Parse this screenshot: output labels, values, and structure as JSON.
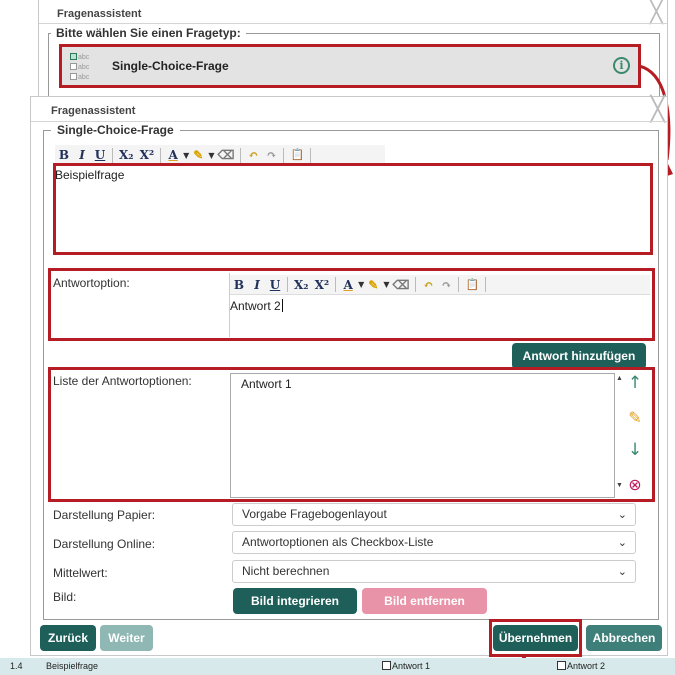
{
  "background_dialog": {
    "title": "Fragenassistent",
    "close_glyph": "╳",
    "legend": "Bitte wählen Sie einen Fragetyp:",
    "type_icon_lines": [
      "abc",
      "abc",
      "abc"
    ],
    "selected_type": "Single-Choice-Frage",
    "info_glyph": "i"
  },
  "dialog": {
    "title": "Fragenassistent",
    "close_glyph": "╳",
    "legend": "Single-Choice-Frage"
  },
  "toolbar": {
    "bold": "B",
    "italic": "I",
    "underline": "U",
    "subscript": "X₂",
    "superscript": "X²",
    "font_color": "A",
    "highlight_icon": "✎",
    "clear_format_icon": "⌫",
    "undo_icon": "↶",
    "redo_icon": "↷",
    "paste_icon": "📋",
    "dropdown_glyph": "▼"
  },
  "question": {
    "text": "Beispielfrage"
  },
  "answer": {
    "label": "Antwortoption:",
    "text": "Antwort 2",
    "add_button": "Antwort hinzufügen"
  },
  "list": {
    "label": "Liste der Antwortoptionen:",
    "items": [
      "Antwort 1"
    ],
    "up_icon": "↑",
    "edit_icon": "✎",
    "down_icon": "↓",
    "delete_icon": "⊗",
    "scroll_up": "▲",
    "scroll_down": "▼"
  },
  "settings": {
    "paper_label": "Darstellung Papier:",
    "paper_value": "Vorgabe Fragebogenlayout",
    "online_label": "Darstellung Online:",
    "online_value": "Antwortoptionen als Checkbox-Liste",
    "mean_label": "Mittelwert:",
    "mean_value": "Nicht berechnen",
    "image_label": "Bild:",
    "chevron": "⌄"
  },
  "image_buttons": {
    "integrate": "Bild integrieren",
    "remove": "Bild entfernen"
  },
  "footer_buttons": {
    "back": "Zurück",
    "next": "Weiter",
    "apply": "Übernehmen",
    "cancel": "Abbrechen"
  },
  "preview_row": {
    "number": "1.4",
    "question": "Beispielfrage",
    "option1": "Antwort 1",
    "option2": "Antwort 2"
  },
  "colors": {
    "highlight_red": "#b51c23",
    "primary_button": "#1e5f5a",
    "pink_button": "#e893a8",
    "disabled_button": "#8fb7b3",
    "icon_green": "#3b8a6d",
    "preview_row_bg": "#d7e9ea"
  }
}
